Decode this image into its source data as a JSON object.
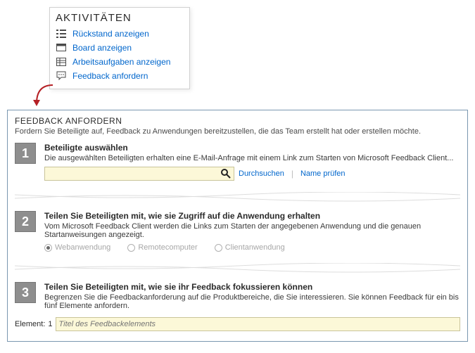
{
  "activities": {
    "title": "AKTIVITÄTEN",
    "items": [
      {
        "label": "Rückstand anzeigen",
        "icon": "backlog-icon"
      },
      {
        "label": "Board anzeigen",
        "icon": "board-icon"
      },
      {
        "label": "Arbeitsaufgaben anzeigen",
        "icon": "workitems-icon"
      },
      {
        "label": "Feedback anfordern",
        "icon": "feedback-icon"
      }
    ]
  },
  "wizard": {
    "title": "FEEDBACK ANFORDERN",
    "intro": "Fordern Sie Beteiligte auf, Feedback zu Anwendungen bereitzustellen, die das Team erstellt hat oder erstellen möchte.",
    "step1": {
      "num": "1",
      "title": "Beteiligte auswählen",
      "desc": "Die ausgewählten Beteiligten erhalten eine E-Mail-Anfrage mit einem Link zum Starten von Microsoft Feedback Client...",
      "search_value": "",
      "browse_label": "Durchsuchen",
      "check_label": "Name prüfen"
    },
    "step2": {
      "num": "2",
      "title": "Teilen Sie Beteiligten mit, wie sie Zugriff auf die Anwendung erhalten",
      "desc": "Vom Microsoft Feedback Client werden die Links zum Starten der angegebenen Anwendung und die genauen Startanweisungen angezeigt.",
      "options": {
        "web": "Webanwendung",
        "remote": "Remotecomputer",
        "client": "Clientanwendung"
      }
    },
    "step3": {
      "num": "3",
      "title": "Teilen Sie Beteiligten mit, wie sie ihr Feedback fokussieren können",
      "desc": "Begrenzen Sie die Feedbackanforderung auf die Produktbereiche, die Sie interessieren. Sie können Feedback für ein bis fünf Elemente anfordern.",
      "element_label": "Element:",
      "element_index": "1",
      "element_placeholder": "Titel des Feedbackelements"
    }
  }
}
